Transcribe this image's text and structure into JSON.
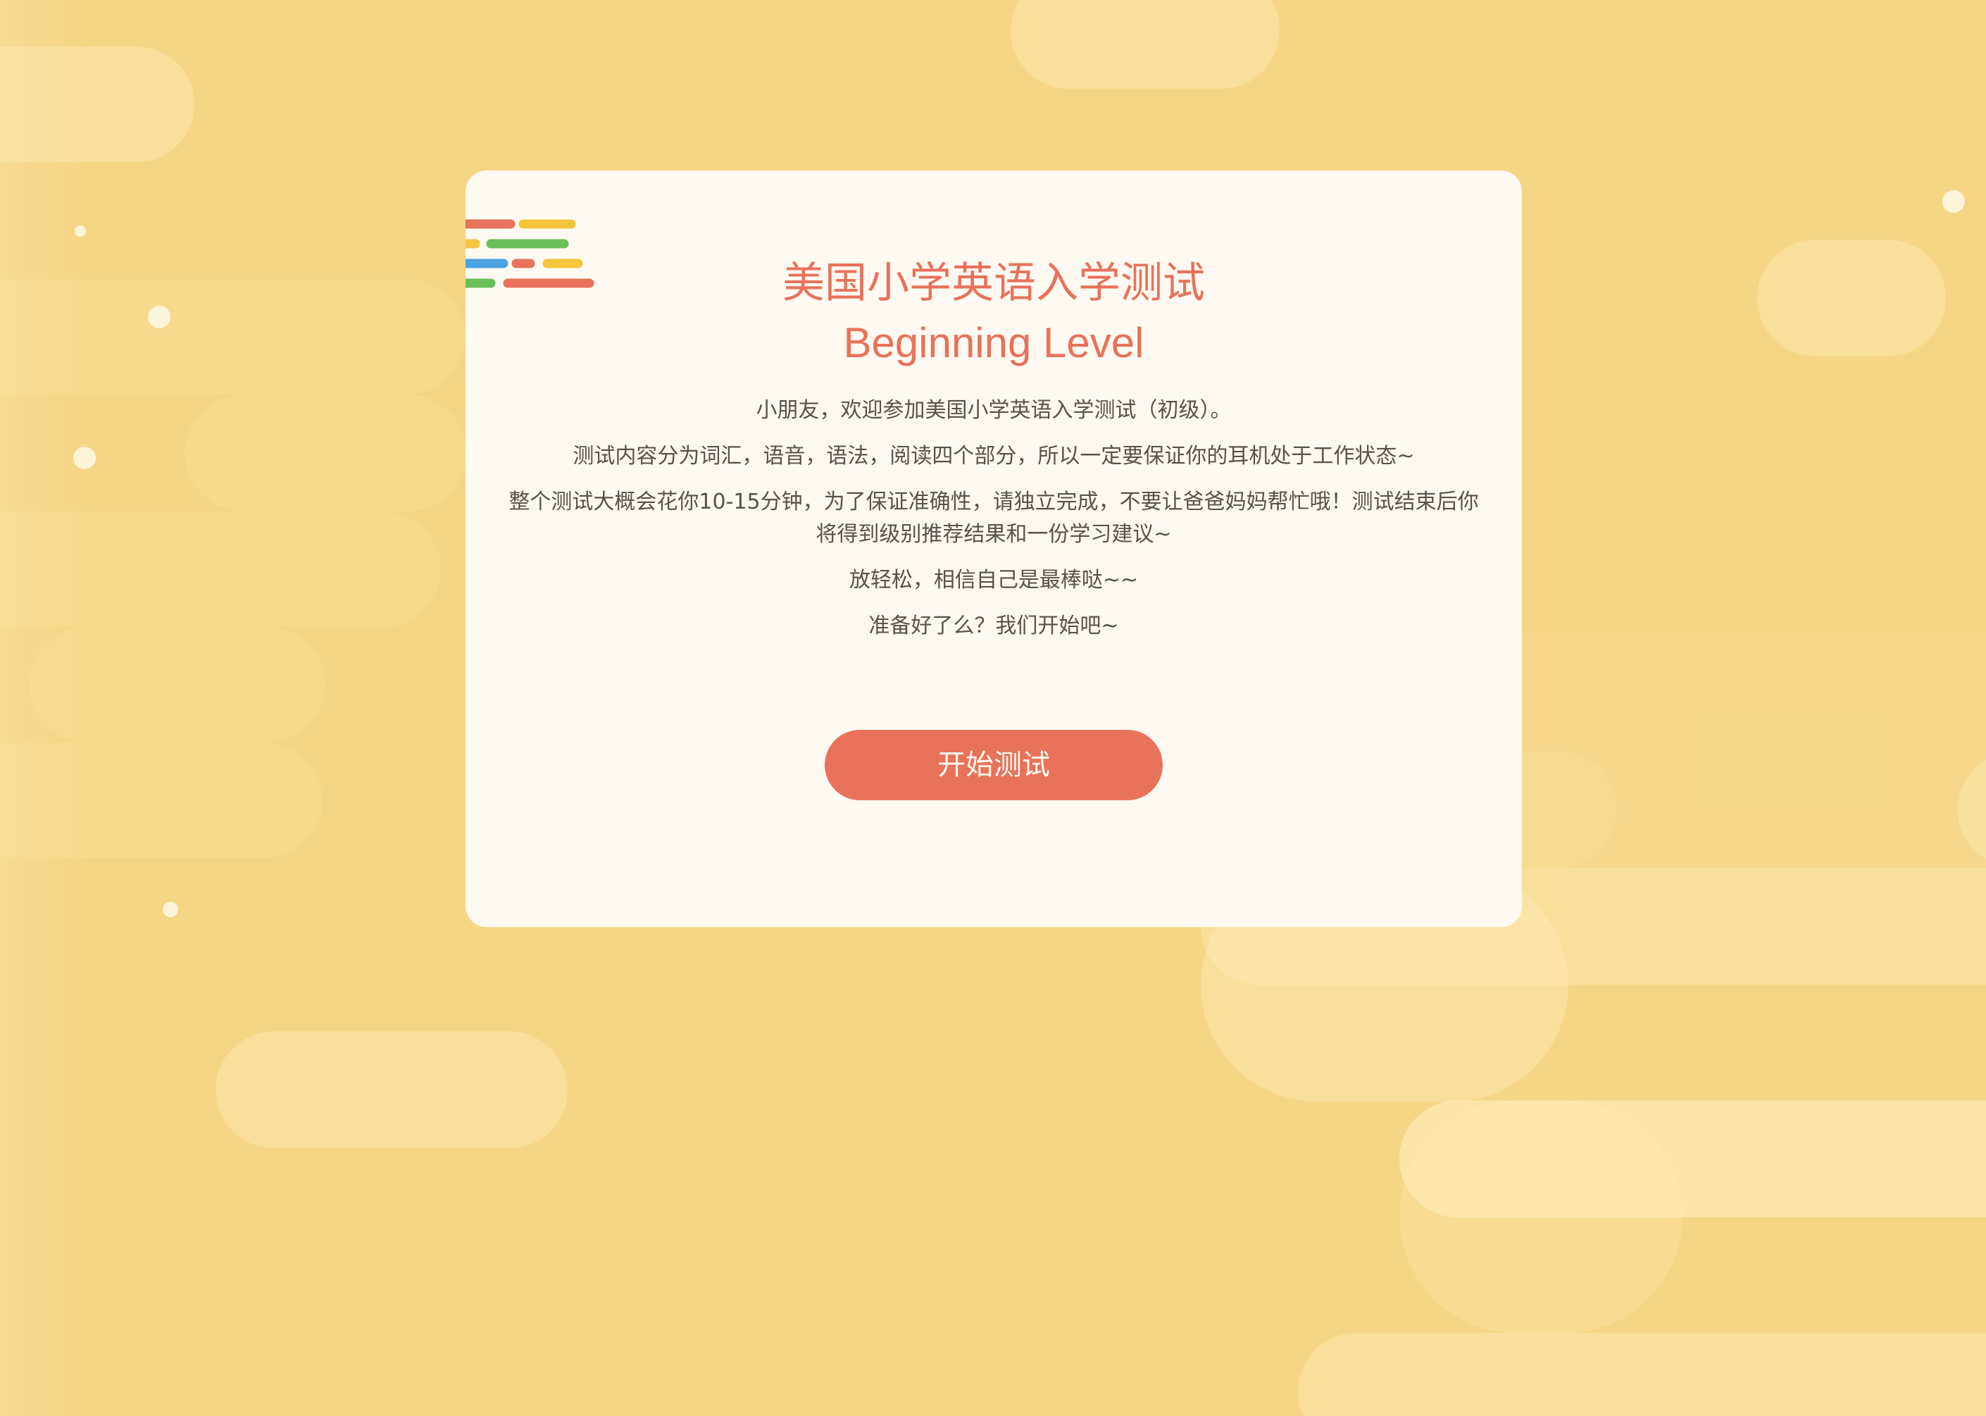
{
  "header": {
    "title_cn": "美国小学英语入学测试",
    "title_en": "Beginning Level"
  },
  "intro": {
    "line1": "小朋友，欢迎参加美国小学英语入学测试（初级）。",
    "line2": "测试内容分为词汇，语音，语法，阅读四个部分，所以一定要保证你的耳机处于工作状态~",
    "line3": "整个测试大概会花你10-15分钟，为了保证准确性，请独立完成，不要让爸爸妈妈帮忙哦！测试结束后你将得到级别推荐结果和一份学习建议~",
    "line4": "放轻松，相信自己是最棒哒~~",
    "line5": "准备好了么？我们开始吧~"
  },
  "actions": {
    "start_label": "开始测试"
  },
  "logo": {
    "icon": "colored-stripes-icon",
    "colors": [
      "#e8725b",
      "#f4c53d",
      "#6bbf59",
      "#4ba3e3"
    ]
  },
  "theme": {
    "background": "#f7d586",
    "card": "#fffaf1",
    "accent": "#e8735a",
    "text": "#5a5148"
  }
}
